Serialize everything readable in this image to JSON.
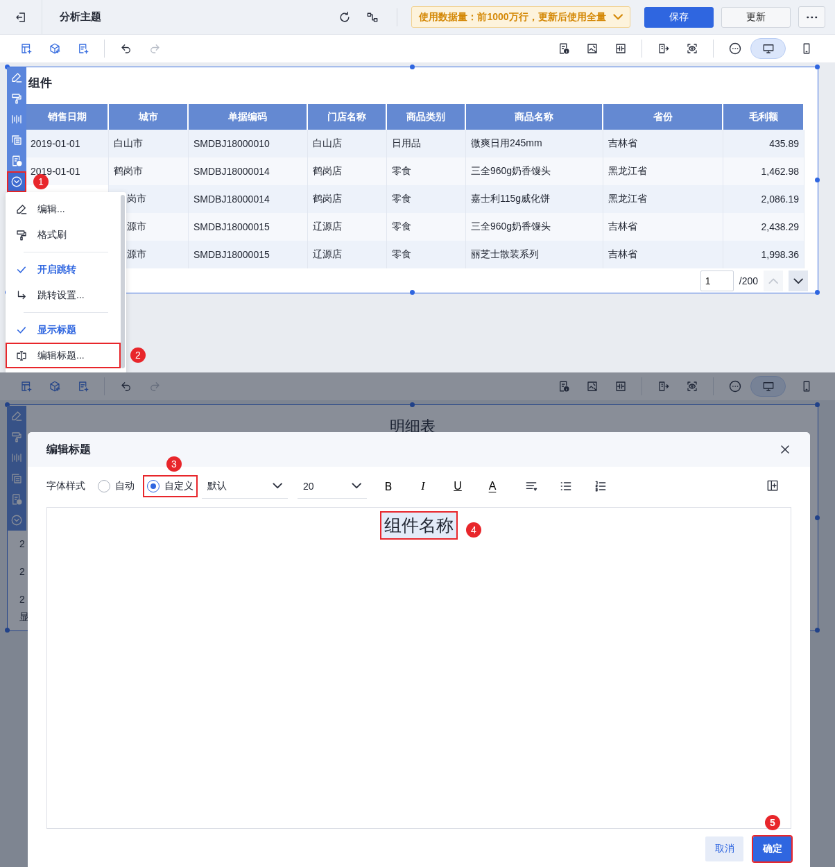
{
  "header": {
    "title": "分析主题",
    "notice": "使用数据量：前1000万行，更新后使用全量",
    "buttons": [
      {
        "label": "保存",
        "kind": "primary"
      },
      {
        "label": "更新",
        "kind": "default"
      }
    ]
  },
  "toolbar": {
    "device_buttons": [
      {
        "kind": "desktop",
        "selected": true
      },
      {
        "kind": "phone",
        "selected": false
      }
    ]
  },
  "component": {
    "title": "组件",
    "side_tools": [
      {
        "kind": "edit",
        "selected": false,
        "highlighted": false
      },
      {
        "kind": "format",
        "selected": false,
        "highlighted": false
      },
      {
        "kind": "bars",
        "selected": false,
        "highlighted": false
      },
      {
        "kind": "copy",
        "selected": false,
        "highlighted": false
      },
      {
        "kind": "info",
        "selected": false,
        "highlighted": false
      },
      {
        "kind": "more",
        "selected": true,
        "highlighted": true,
        "callout": "1"
      }
    ],
    "table": {
      "columns": [
        "销售日期",
        "城市",
        "单据编码",
        "门店名称",
        "商品类别",
        "商品名称",
        "省份",
        "毛利额"
      ],
      "rows": [
        {
          "cells": [
            "2019-01-01",
            "白山市",
            "SMDBJ18000010",
            "白山店",
            "日用品",
            "微爽日用245mm",
            "吉林省",
            "435.89"
          ]
        },
        {
          "cells": [
            "2019-01-01",
            "鹤岗市",
            "SMDBJ18000014",
            "鹤岗店",
            "零食",
            "三全960g奶香馒头",
            "黑龙江省",
            "1,462.98"
          ]
        },
        {
          "cells": [
            null,
            "岗市",
            "SMDBJ18000014",
            "鹤岗店",
            "零食",
            "嘉士利115g威化饼",
            "黑龙江省",
            "2,086.19"
          ]
        },
        {
          "cells": [
            null,
            "源市",
            "SMDBJ18000015",
            "辽源店",
            "零食",
            "三全960g奶香馒头",
            "吉林省",
            "2,438.29"
          ]
        },
        {
          "cells": [
            null,
            "源市",
            "SMDBJ18000015",
            "辽源店",
            "零食",
            "丽芝士散装系列",
            "吉林省",
            "1,998.36"
          ]
        }
      ]
    },
    "pager": {
      "page": "1",
      "total": "/200",
      "buttons": [
        {
          "kind": "up",
          "disabled": true
        },
        {
          "kind": "down",
          "disabled": false
        }
      ]
    }
  },
  "menu": {
    "items": [
      {
        "kind": "edit",
        "label": "编辑...",
        "checked": false,
        "highlighted": false
      },
      {
        "kind": "format",
        "label": "格式刷",
        "checked": false,
        "highlighted": false
      },
      {
        "kind": "divider"
      },
      {
        "kind": "toggle",
        "label": "开启跳转",
        "checked": true,
        "highlighted": false
      },
      {
        "kind": "jump",
        "label": "跳转设置...",
        "checked": false,
        "highlighted": false
      },
      {
        "kind": "divider"
      },
      {
        "kind": "toggle",
        "label": "显示标题",
        "checked": true,
        "highlighted": false
      },
      {
        "kind": "title",
        "label": "编辑标题...",
        "checked": false,
        "highlighted": true,
        "callout": "2"
      }
    ]
  },
  "bottom_toolbar": {
    "device_buttons": [
      {
        "kind": "desktop",
        "selected": true
      },
      {
        "kind": "phone",
        "selected": false
      }
    ]
  },
  "background": {
    "title": "明细表",
    "peek_texts": [
      "2",
      "2",
      "2",
      "显"
    ],
    "side_tools": [
      {
        "kind": "edit",
        "selected": false,
        "highlighted": false
      },
      {
        "kind": "format",
        "selected": false,
        "highlighted": false
      },
      {
        "kind": "bars",
        "selected": false,
        "highlighted": false
      },
      {
        "kind": "copy",
        "selected": false,
        "highlighted": false
      },
      {
        "kind": "info",
        "selected": false,
        "highlighted": false
      },
      {
        "kind": "more",
        "selected": false,
        "highlighted": false
      }
    ]
  },
  "dialog": {
    "title": "编辑标题",
    "font_style": {
      "label": "字体样式",
      "options": [
        {
          "label": "自动",
          "selected": false,
          "highlighted": false
        },
        {
          "label": "自定义",
          "selected": true,
          "highlighted": true,
          "callout": "3"
        }
      ]
    },
    "font_family": "默认",
    "font_size": "20",
    "format_buttons": [
      {
        "kind": "bold",
        "label": "B"
      },
      {
        "kind": "italic",
        "label": "I"
      },
      {
        "kind": "underline",
        "label": "U"
      },
      {
        "kind": "color",
        "label": "A"
      }
    ],
    "editor": {
      "text": "组件名称",
      "highlighted": true,
      "callout": "4"
    },
    "buttons": [
      {
        "label": "取消",
        "kind": "default",
        "highlighted": false
      },
      {
        "label": "确定",
        "kind": "primary",
        "highlighted": true,
        "callout": "5"
      }
    ]
  }
}
